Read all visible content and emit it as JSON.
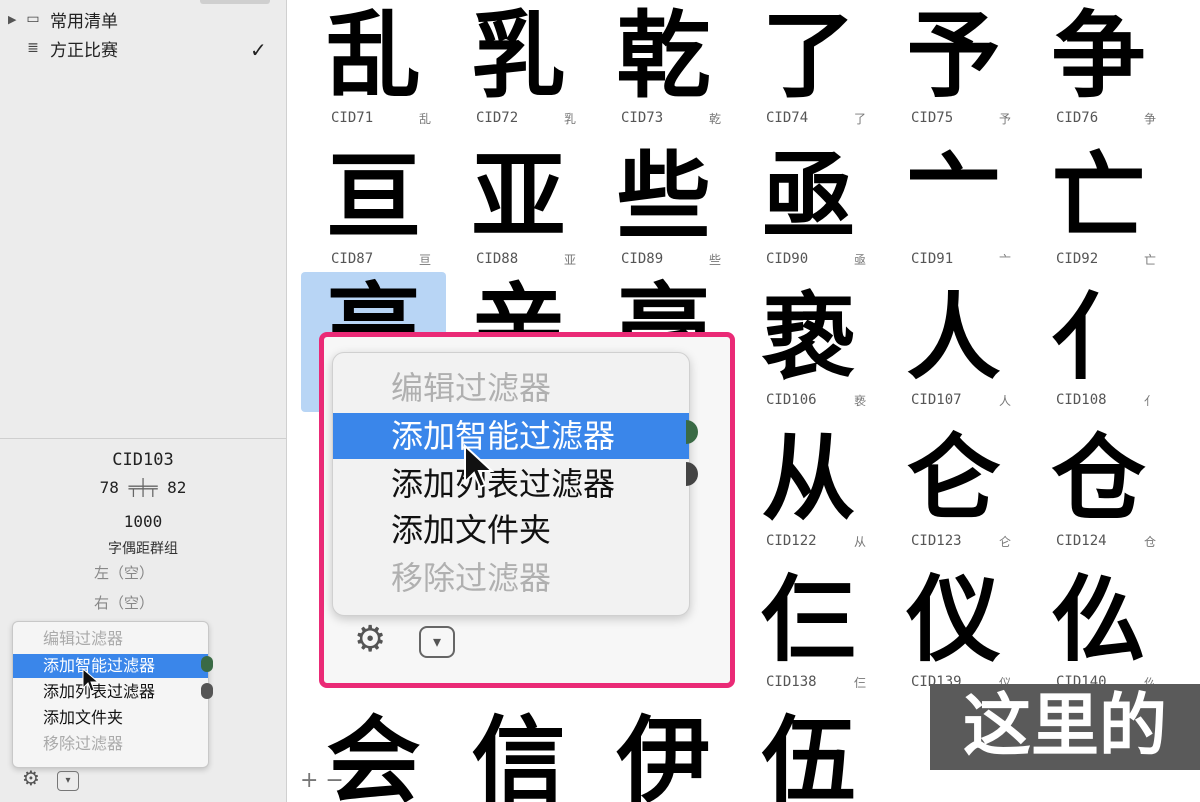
{
  "sidebar": {
    "items": [
      {
        "label": "常用清单",
        "icon": "folder-icon"
      },
      {
        "label": "方正比赛",
        "icon": "list-icon",
        "checked": true
      }
    ],
    "check_mark": "✓",
    "glyph_info": {
      "name": "CID103",
      "left_bearing": "78",
      "right_bearing": "82",
      "advance": "1000",
      "kerning_group_label": "字偶距群组",
      "left_label": "左",
      "left_value": "（空）",
      "right_label": "右",
      "right_value": "（空）"
    },
    "gear_icon": "⚙",
    "popup_icon": "▾"
  },
  "filter_menu": {
    "items": [
      {
        "label": "编辑过滤器",
        "state": "disabled"
      },
      {
        "label": "添加智能过滤器",
        "state": "selected"
      },
      {
        "label": "添加列表过滤器",
        "state": "enabled"
      },
      {
        "label": "添加文件夹",
        "state": "enabled"
      },
      {
        "label": "移除过滤器",
        "state": "disabled"
      }
    ]
  },
  "glyphs": [
    {
      "glyph": "乱",
      "cid": "CID71",
      "ch": "乱"
    },
    {
      "glyph": "乳",
      "cid": "CID72",
      "ch": "乳"
    },
    {
      "glyph": "乾",
      "cid": "CID73",
      "ch": "乾"
    },
    {
      "glyph": "了",
      "cid": "CID74",
      "ch": "了"
    },
    {
      "glyph": "予",
      "cid": "CID75",
      "ch": "予"
    },
    {
      "glyph": "争",
      "cid": "CID76",
      "ch": "争"
    },
    {
      "glyph": "亘",
      "cid": "CID87",
      "ch": "亘"
    },
    {
      "glyph": "亚",
      "cid": "CID88",
      "ch": "亚"
    },
    {
      "glyph": "些",
      "cid": "CID89",
      "ch": "些"
    },
    {
      "glyph": "亟",
      "cid": "CID90",
      "ch": "亟"
    },
    {
      "glyph": "亠",
      "cid": "CID91",
      "ch": "亠"
    },
    {
      "glyph": "亡",
      "cid": "CID92",
      "ch": "亡"
    },
    {
      "glyph": "亵",
      "cid": "CID106",
      "ch": "亵"
    },
    {
      "glyph": "人",
      "cid": "CID107",
      "ch": "人"
    },
    {
      "glyph": "亻",
      "cid": "CID108",
      "ch": "亻"
    },
    {
      "glyph": "从",
      "cid": "CID122",
      "ch": "从"
    },
    {
      "glyph": "仑",
      "cid": "CID123",
      "ch": "仑"
    },
    {
      "glyph": "仓",
      "cid": "CID124",
      "ch": "仓"
    },
    {
      "glyph": "仨",
      "cid": "CID138",
      "ch": "仨"
    },
    {
      "glyph": "仪",
      "cid": "CID139",
      "ch": "仪"
    },
    {
      "glyph": "仫",
      "cid": "CID140",
      "ch": "仫"
    }
  ],
  "partial_glyphs": [
    "亮",
    "亲",
    "亳",
    "会",
    "信",
    "伊",
    "伍"
  ],
  "add_remove": "+ −",
  "subtitle": "这里的"
}
